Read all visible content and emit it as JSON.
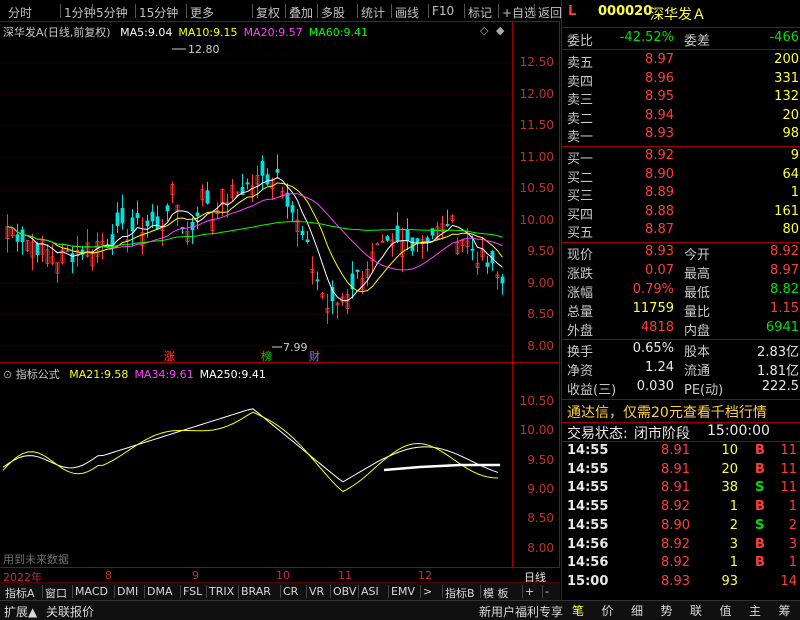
{
  "toolbar": {
    "items": [
      "分时",
      "1分钟",
      "5分钟",
      "15分钟",
      "更多",
      "复权",
      "叠加",
      "多股",
      "统计",
      "画线",
      "F10",
      "标记",
      "+自选",
      "返回"
    ]
  },
  "main_chart": {
    "title": "深华发A(日线,前复权)",
    "ma": [
      {
        "label": "MA5:",
        "value": "9.04",
        "color": "#ffffff"
      },
      {
        "label": "MA10:",
        "value": "9.15",
        "color": "#ffff00"
      },
      {
        "label": "MA20:",
        "value": "9.57",
        "color": "#ff40ff"
      },
      {
        "label": "MA60:",
        "value": "9.41",
        "color": "#00ff00"
      }
    ],
    "yticks": [
      "12.50",
      "12.00",
      "11.50",
      "11.00",
      "10.50",
      "10.00",
      "9.50",
      "9.00",
      "8.50",
      "8.00"
    ],
    "high_label": "12.80",
    "low_label": "7.99",
    "markers": [
      "涨",
      "榜",
      "财"
    ]
  },
  "indicator": {
    "title": "指标公式",
    "lines": [
      {
        "label": "MA21:",
        "value": "9.58",
        "color": "#ffff00"
      },
      {
        "label": "MA34:",
        "value": "9.61",
        "color": "#ff40ff"
      },
      {
        "label": "MA250:",
        "value": "9.41",
        "color": "#ffffff"
      }
    ],
    "yticks": [
      "10.50",
      "10.00",
      "9.50",
      "9.00",
      "8.50",
      "8.00"
    ],
    "warning": "用到未来数据"
  },
  "date_axis": {
    "year": "2022年",
    "months": [
      "8",
      "9",
      "10",
      "11",
      "12"
    ],
    "period": "日线"
  },
  "indicator_tabs": [
    "指标A",
    "窗口",
    "MACD",
    "DMI",
    "DMA",
    "FSL",
    "TRIX",
    "BRAR",
    "CR",
    "VR",
    "OBV",
    "ASI",
    "EMV",
    ">",
    "指标B",
    "模 板",
    "+",
    "-"
  ],
  "bottom_bar": {
    "left": [
      "扩展▲",
      "关联报价"
    ],
    "promo": "新用户福利专享",
    "buttons": [
      "笔",
      "价",
      "细",
      "势",
      "联",
      "值",
      "主",
      "筹"
    ]
  },
  "quote": {
    "code": "000020",
    "name": "深华发Ａ",
    "flag": "L",
    "weibi": {
      "label": "委比",
      "value": "-42.52%",
      "label2": "委差",
      "value2": "-466"
    },
    "asks": [
      {
        "label": "卖五",
        "price": "8.97",
        "vol": "200"
      },
      {
        "label": "卖四",
        "price": "8.96",
        "vol": "331"
      },
      {
        "label": "卖三",
        "price": "8.95",
        "vol": "132"
      },
      {
        "label": "卖二",
        "price": "8.94",
        "vol": "20"
      },
      {
        "label": "卖一",
        "price": "8.93",
        "vol": "98"
      }
    ],
    "bids": [
      {
        "label": "买一",
        "price": "8.92",
        "vol": "9"
      },
      {
        "label": "买二",
        "price": "8.90",
        "vol": "64"
      },
      {
        "label": "买三",
        "price": "8.89",
        "vol": "1"
      },
      {
        "label": "买四",
        "price": "8.88",
        "vol": "161"
      },
      {
        "label": "买五",
        "price": "8.87",
        "vol": "80"
      }
    ],
    "stats": [
      {
        "l1": "现价",
        "v1": "8.93",
        "c1": "red",
        "l2": "今开",
        "v2": "8.92",
        "c2": "red"
      },
      {
        "l1": "涨跌",
        "v1": "0.07",
        "c1": "red",
        "l2": "最高",
        "v2": "8.97",
        "c2": "red"
      },
      {
        "l1": "涨幅",
        "v1": "0.79%",
        "c1": "red",
        "l2": "最低",
        "v2": "8.82",
        "c2": "green"
      },
      {
        "l1": "总量",
        "v1": "11759",
        "c1": "yellow",
        "l2": "量比",
        "v2": "1.15",
        "c2": "red"
      },
      {
        "l1": "外盘",
        "v1": "4818",
        "c1": "red",
        "l2": "内盘",
        "v2": "6941",
        "c2": "green"
      }
    ],
    "stats2": [
      {
        "l1": "换手",
        "v1": "0.65%",
        "l2": "股本",
        "v2": "2.83亿"
      },
      {
        "l1": "净资",
        "v1": "1.24",
        "l2": "流通",
        "v2": "1.81亿"
      },
      {
        "l1": "收益(三)",
        "v1": "0.030",
        "l2": "PE(动)",
        "v2": "222.5"
      }
    ],
    "promo": "通达信，仅需20元查看千档行情",
    "status_label": "交易状态:",
    "status_value": "闭市阶段",
    "status_time": "15:00:00",
    "ticks": [
      {
        "t": "14:55",
        "p": "8.91",
        "v": "10",
        "bs": "B",
        "n": "11"
      },
      {
        "t": "14:55",
        "p": "8.91",
        "v": "20",
        "bs": "B",
        "n": "11"
      },
      {
        "t": "14:55",
        "p": "8.91",
        "v": "38",
        "bs": "S",
        "n": "11"
      },
      {
        "t": "14:55",
        "p": "8.92",
        "v": "1",
        "bs": "B",
        "n": "1"
      },
      {
        "t": "14:55",
        "p": "8.90",
        "v": "2",
        "bs": "S",
        "n": "2"
      },
      {
        "t": "14:56",
        "p": "8.92",
        "v": "3",
        "bs": "B",
        "n": "3"
      },
      {
        "t": "14:56",
        "p": "8.92",
        "v": "1",
        "bs": "B",
        "n": "1"
      },
      {
        "t": "15:00",
        "p": "8.93",
        "v": "93",
        "bs": "",
        "n": "14"
      }
    ]
  },
  "colors": {
    "up": "#ff3c3c",
    "down": "#00e0e0",
    "border": "#a00000",
    "ma5": "#ffffff",
    "ma10": "#ffff00",
    "ma20": "#ff40ff",
    "ma60": "#00ff00"
  }
}
